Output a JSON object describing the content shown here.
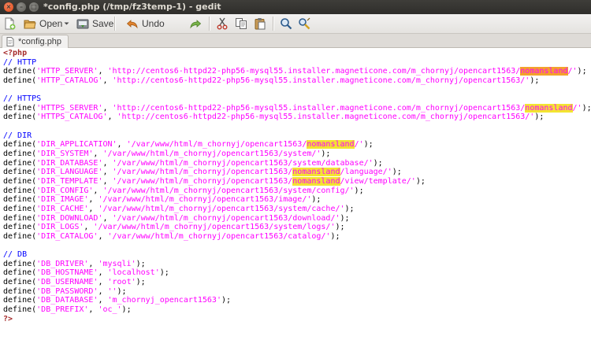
{
  "window": {
    "title": "*config.php (/tmp/fz3temp-1) - gedit"
  },
  "toolbar": {
    "open_label": "Open",
    "save_label": "Save",
    "undo_label": "Undo",
    "icons": [
      "new-document-icon",
      "open-folder-icon",
      "chevron-down-icon",
      "save-icon",
      "undo-arrow-icon",
      "redo-arrow-icon",
      "cut-scissors-icon",
      "copy-icon",
      "paste-clipboard-icon",
      "find-magnifier-icon",
      "replace-icon"
    ]
  },
  "tab": {
    "label": "*config.php"
  },
  "editor": {
    "highlight": "nomansland",
    "lines": [
      {
        "t": "<?php"
      },
      {
        "t": "// HTTP"
      },
      {
        "t": "define('HTTP_SERVER', 'http://centos6-httpd22-php56-mysql55.installer.magneticone.com/m_chornyj/opencart1563/nomansland/');"
      },
      {
        "t": "define('HTTP_CATALOG', 'http://centos6-httpd22-php56-mysql55.installer.magneticone.com/m_chornyj/opencart1563/');"
      },
      {
        "t": ""
      },
      {
        "t": "// HTTPS"
      },
      {
        "t": "define('HTTPS_SERVER', 'http://centos6-httpd22-php56-mysql55.installer.magneticone.com/m_chornyj/opencart1563/nomansland/');"
      },
      {
        "t": "define('HTTPS_CATALOG', 'http://centos6-httpd22-php56-mysql55.installer.magneticone.com/m_chornyj/opencart1563/');"
      },
      {
        "t": ""
      },
      {
        "t": "// DIR"
      },
      {
        "t": "define('DIR_APPLICATION', '/var/www/html/m_chornyj/opencart1563/nomansland/');"
      },
      {
        "t": "define('DIR_SYSTEM', '/var/www/html/m_chornyj/opencart1563/system/');"
      },
      {
        "t": "define('DIR_DATABASE', '/var/www/html/m_chornyj/opencart1563/system/database/');"
      },
      {
        "t": "define('DIR_LANGUAGE', '/var/www/html/m_chornyj/opencart1563/nomansland/language/');"
      },
      {
        "t": "define('DIR_TEMPLATE', '/var/www/html/m_chornyj/opencart1563/nomansland/view/template/');"
      },
      {
        "t": "define('DIR_CONFIG', '/var/www/html/m_chornyj/opencart1563/system/config/');"
      },
      {
        "t": "define('DIR_IMAGE', '/var/www/html/m_chornyj/opencart1563/image/');"
      },
      {
        "t": "define('DIR_CACHE', '/var/www/html/m_chornyj/opencart1563/system/cache/');"
      },
      {
        "t": "define('DIR_DOWNLOAD', '/var/www/html/m_chornyj/opencart1563/download/');"
      },
      {
        "t": "define('DIR_LOGS', '/var/www/html/m_chornyj/opencart1563/system/logs/');"
      },
      {
        "t": "define('DIR_CATALOG', '/var/www/html/m_chornyj/opencart1563/catalog/');"
      },
      {
        "t": ""
      },
      {
        "t": "// DB"
      },
      {
        "t": "define('DB_DRIVER', 'mysqli');"
      },
      {
        "t": "define('DB_HOSTNAME', 'localhost');"
      },
      {
        "t": "define('DB_USERNAME', 'root');"
      },
      {
        "t": "define('DB_PASSWORD', '');"
      },
      {
        "t": "define('DB_DATABASE', 'm_chornyj_opencart1563');"
      },
      {
        "t": "define('DB_PREFIX', 'oc_');"
      },
      {
        "t": "?>"
      }
    ]
  }
}
